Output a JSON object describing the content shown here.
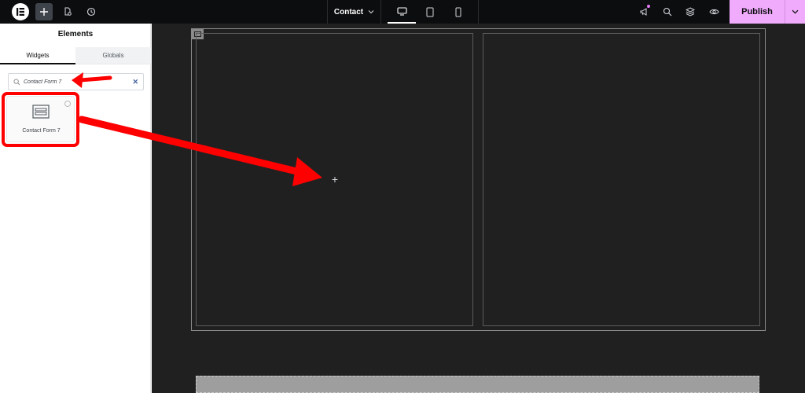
{
  "topbar": {
    "page_name": "Contact",
    "publish_label": "Publish",
    "icons": {
      "logo": "elementor-logo-icon",
      "add": "plus-icon",
      "page_settings": "page-settings-icon",
      "history": "history-icon",
      "desktop": "desktop-icon",
      "tablet": "tablet-icon",
      "mobile": "mobile-icon",
      "whats_new": "megaphone-icon",
      "finder": "search-icon",
      "structure": "layers-icon",
      "preview": "eye-icon"
    },
    "colors": {
      "bar": "#0c0d0e",
      "publish": "#f0abfc",
      "notification": "#e879f9"
    }
  },
  "sidebar": {
    "title": "Elements",
    "tabs": [
      {
        "label": "Widgets",
        "active": true
      },
      {
        "label": "Globals",
        "active": false
      }
    ],
    "search": {
      "value": "Contact Form 7",
      "clear_label": "✕"
    },
    "results": [
      {
        "label": "Contact Form 7",
        "icon": "form-widget-icon"
      }
    ]
  },
  "canvas": {
    "background": "#202020",
    "add_glyph": "+",
    "columns": 2
  },
  "annotations": {
    "color": "#ff0000",
    "highlights": [
      "search-input",
      "contact-form-7-widget"
    ],
    "arrows": [
      "points-to-search",
      "drag-widget-to-column"
    ]
  }
}
